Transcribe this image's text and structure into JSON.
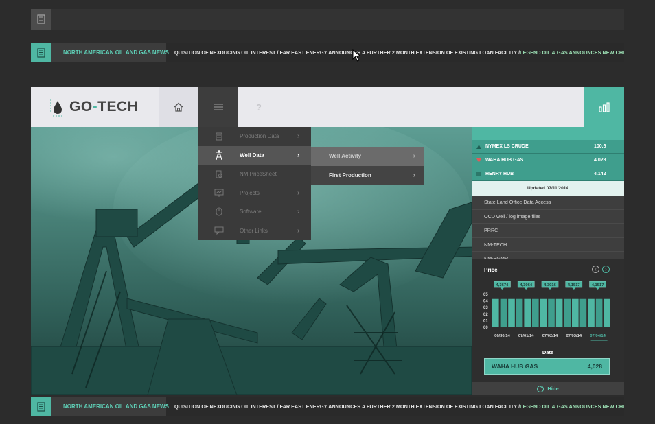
{
  "ticker": {
    "label": "NORTH AMERICAN OIL AND GAS NEWS",
    "text_white_1": "QUISITION OF NEXDUCING OIL INTEREST / FAR EAST ENERGY ANNOUNCES A FURTHER 2 MONTH EXTENSION OF EXISTING LOAN FACILITY / ",
    "text_green_1": "LEGEND OIL & GAS ANNOUNCES NEW CHIEF RESTRUCTURING OFFICER AND NEW C"
  },
  "header": {
    "logo_text_1": "GO",
    "logo_text_sep": "-",
    "logo_text_2": "TECH",
    "help_label": "?"
  },
  "menu": {
    "items": [
      {
        "label": "Production Data",
        "icon": "database-icon"
      },
      {
        "label": "Well Data",
        "icon": "derrick-icon"
      },
      {
        "label": "NM PriceSheet",
        "icon": "pricesheet-icon"
      },
      {
        "label": "Projects",
        "icon": "presentation-icon"
      },
      {
        "label": "Software",
        "icon": "mouse-icon"
      },
      {
        "label": "Other Links",
        "icon": "chat-icon"
      }
    ],
    "submenu": [
      {
        "label": "Well Activity"
      },
      {
        "label": "First Production"
      }
    ]
  },
  "sidebar": {
    "prices": [
      {
        "name": "NYMEX LS CRUDE",
        "value": "100.6",
        "trend": "up"
      },
      {
        "name": "WAHA HUB GAS",
        "value": "4.028",
        "trend": "down"
      },
      {
        "name": "HENRY HUB",
        "value": "4.142",
        "trend": "flat"
      }
    ],
    "updated": "Updated 07/11/2014",
    "links": [
      "State Land Office Data Access",
      "OCD well / log image files",
      "PRRC",
      "NM-TECH",
      "NM-BGMR"
    ],
    "price_title": "Price",
    "selected_series": "WAHA HUB GAS",
    "selected_value": "4,028",
    "hide_label": "Hide"
  },
  "colors": {
    "accent": "#4fb7a3",
    "up": "#4fb7a3",
    "down": "#e05a5a"
  },
  "chart_data": {
    "type": "bar",
    "xlabel": "Date",
    "ylabel": "",
    "ylim": [
      0,
      5
    ],
    "yticks": [
      "05",
      "04",
      "03",
      "02",
      "01",
      "00"
    ],
    "categories": [
      "06/30/14",
      "07/01/14",
      "07/02/14",
      "07/03/14",
      "07/04/14"
    ],
    "bar_heights": [
      4.3,
      4.3,
      4.3,
      4.3,
      4.3,
      4.3,
      4.3,
      4.3,
      4.3,
      4.3,
      4.3,
      4.3,
      4.3,
      4.3,
      4.3
    ],
    "data_labels": [
      "4,3674",
      "4,3064",
      "4,3016",
      "4,1517",
      "4,1517"
    ]
  }
}
